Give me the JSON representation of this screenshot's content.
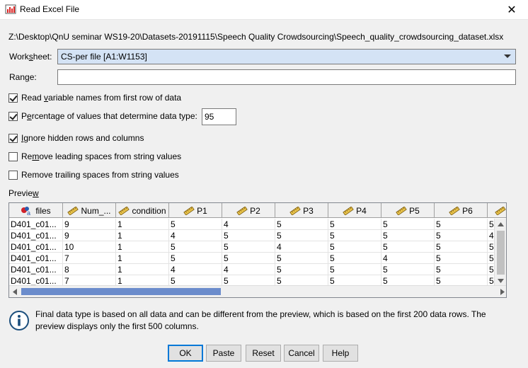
{
  "window": {
    "title": "Read Excel File",
    "close_label": "✕"
  },
  "file_path": "Z:\\Desktop\\QnU seminar WS19-20\\Datasets-20191115\\Speech Quality Crowdsourcing\\Speech_quality_crowdsourcing_dataset.xlsx",
  "worksheet": {
    "label_pre": "Work",
    "label_u": "s",
    "label_post": "heet:",
    "value": "CS-per file [A1:W1153]"
  },
  "range": {
    "label_pre": "Ran",
    "label_u": "g",
    "label_post": "e:",
    "value": ""
  },
  "options": [
    {
      "pre": "Read ",
      "u": "v",
      "post": "ariable names from first row of data",
      "checked": true
    },
    {
      "pre": "P",
      "u": "e",
      "post": "rcentage of values that determine data type:",
      "checked": true
    },
    {
      "pre": "",
      "u": "I",
      "post": "gnore hidden rows and columns",
      "checked": true
    },
    {
      "pre": "Re",
      "u": "m",
      "post": "ove leading spaces from string values",
      "checked": false
    },
    {
      "pre": "Remove trailin",
      "u": "g",
      "post": " spaces from string values",
      "checked": false
    }
  ],
  "percentage_value": "95",
  "preview": {
    "label_pre": "Previe",
    "label_u": "w",
    "columns": [
      {
        "name": "files",
        "icon": "nominal-string-icon"
      },
      {
        "name": "Num_...",
        "icon": "scale-ruler-icon"
      },
      {
        "name": "condition",
        "icon": "scale-ruler-icon"
      },
      {
        "name": "P1",
        "icon": "scale-ruler-icon"
      },
      {
        "name": "P2",
        "icon": "scale-ruler-icon"
      },
      {
        "name": "P3",
        "icon": "scale-ruler-icon"
      },
      {
        "name": "P4",
        "icon": "scale-ruler-icon"
      },
      {
        "name": "P5",
        "icon": "scale-ruler-icon"
      },
      {
        "name": "P6",
        "icon": "scale-ruler-icon"
      },
      {
        "name": "",
        "icon": "scale-ruler-icon"
      }
    ],
    "rows": [
      [
        "D401_c01...",
        "9",
        "1",
        "5",
        "4",
        "5",
        "5",
        "5",
        "5",
        "5"
      ],
      [
        "D401_c01...",
        "9",
        "1",
        "4",
        "5",
        "5",
        "5",
        "5",
        "5",
        "4"
      ],
      [
        "D401_c01...",
        "10",
        "1",
        "5",
        "5",
        "4",
        "5",
        "5",
        "5",
        "5"
      ],
      [
        "D401_c01...",
        "7",
        "1",
        "5",
        "5",
        "5",
        "5",
        "4",
        "5",
        "5"
      ],
      [
        "D401_c01...",
        "8",
        "1",
        "4",
        "4",
        "5",
        "5",
        "5",
        "5",
        "5"
      ],
      [
        "D401_c01...",
        "7",
        "1",
        "5",
        "5",
        "5",
        "5",
        "5",
        "5",
        "5"
      ]
    ]
  },
  "info_text": "Final data type is based on all data and can be different from the preview, which is based on the first 200 data rows. The preview displays only the first 500 columns.",
  "buttons": {
    "ok": "OK",
    "paste": "Paste",
    "reset": "Reset",
    "cancel": "Cancel",
    "help": "Help"
  },
  "colors": {
    "accent": "#0078d7",
    "select_bg": "#d4e3f5",
    "scroll_thumb": "#6b8ccc"
  }
}
